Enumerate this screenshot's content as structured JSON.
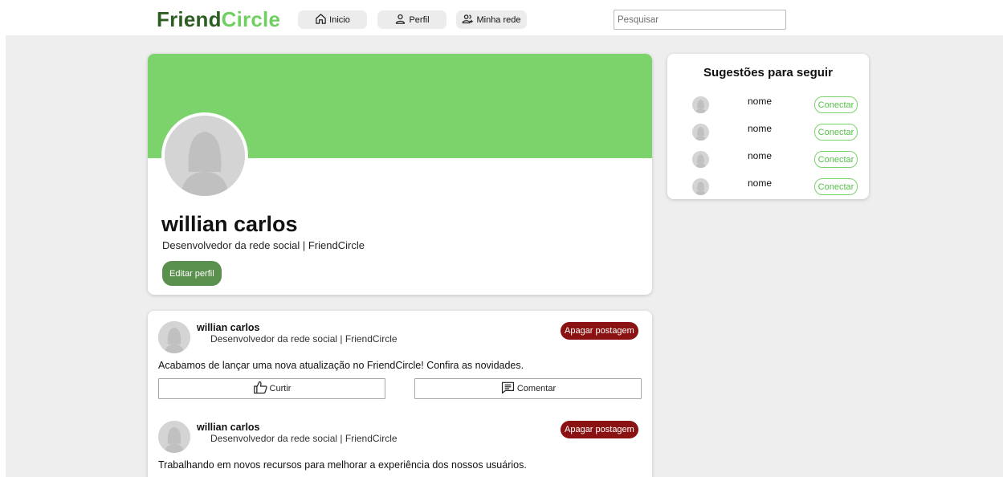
{
  "brand": {
    "part1": "Friend",
    "part2": "Circle"
  },
  "nav": [
    {
      "label": "Inicio",
      "icon": "home-icon"
    },
    {
      "label": "Perfil",
      "icon": "user-icon"
    },
    {
      "label": "Minha rede",
      "icon": "users-icon"
    }
  ],
  "search": {
    "placeholder": "Pesquisar",
    "value": ""
  },
  "profile": {
    "name": "willian carlos",
    "bio": "Desenvolvedor da rede social | FriendCircle",
    "edit_label": "Editar perfil"
  },
  "posts": [
    {
      "author": "willian carlos",
      "subtitle": "Desenvolvedor da rede social | FriendCircle",
      "delete_label": "Apagar postagem",
      "text": "Acabamos de lançar uma nova atualização no FriendCircle! Confira as novidades.",
      "like_label": "Curtir",
      "comment_label": "Comentar"
    },
    {
      "author": "willian carlos",
      "subtitle": "Desenvolvedor da rede social | FriendCircle",
      "delete_label": "Apagar postagem",
      "text": "Trabalhando em novos recursos para melhorar a experiência dos nossos usuários."
    }
  ],
  "suggestions": {
    "title": "Sugestões para seguir",
    "items": [
      {
        "name": "nome",
        "button": "Conectar"
      },
      {
        "name": "nome",
        "button": "Conectar"
      },
      {
        "name": "nome",
        "button": "Conectar"
      },
      {
        "name": "nome",
        "button": "Conectar"
      }
    ]
  },
  "colors": {
    "brand_dark": "#2c5e21",
    "brand_light": "#6fd061",
    "cover": "#7dd36b",
    "edit_button": "#5a904d",
    "delete_button": "#8b1212",
    "connect_border": "#7bd36c",
    "background": "#eeeeee"
  }
}
